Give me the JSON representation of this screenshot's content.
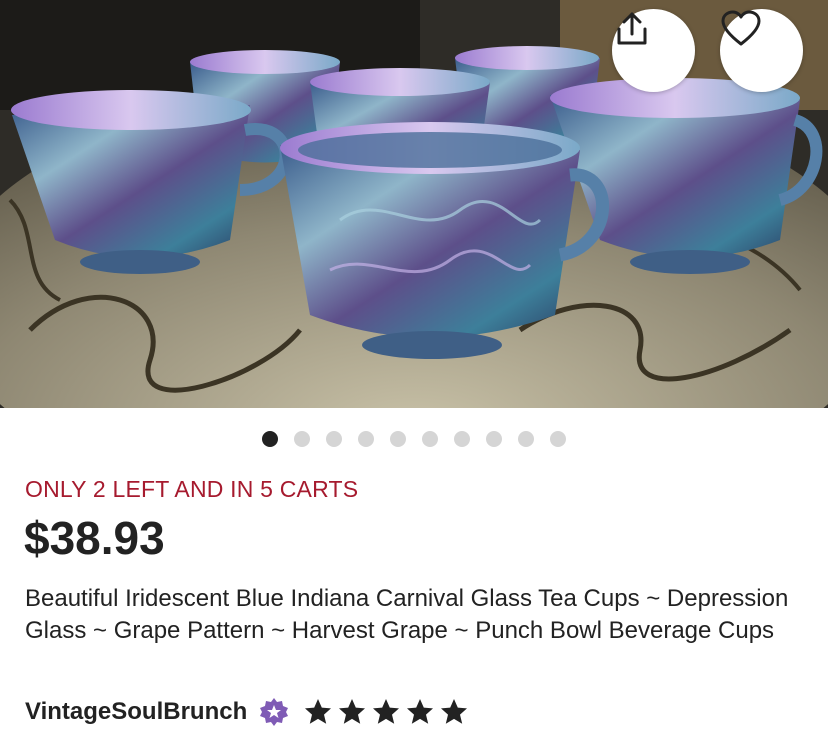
{
  "listing": {
    "image_alt": "Iridescent blue carnival glass tea cups on a decorative mirrored tray",
    "gallery": {
      "count": 10,
      "active_index": 0
    },
    "stock_notice": "ONLY 2 LEFT AND IN 5 CARTS",
    "price": "$38.93",
    "title": "Beautiful Iridescent Blue Indiana Carnival Glass Tea Cups ~ Depression Glass ~ Grape Pattern ~ Harvest Grape ~ Punch Bowl Beverage Cups",
    "shop": {
      "name": "VintageSoulBrunch",
      "badge_icon": "star-seller-badge-icon",
      "rating": 5,
      "rating_max": 5
    }
  },
  "actions": {
    "share_icon": "share-icon",
    "favorite_icon": "heart-icon"
  },
  "colors": {
    "stock_notice": "#a61a2e",
    "badge": "#7f5bb5",
    "active_dot": "#222222",
    "inactive_dot": "#d5d5d5"
  }
}
